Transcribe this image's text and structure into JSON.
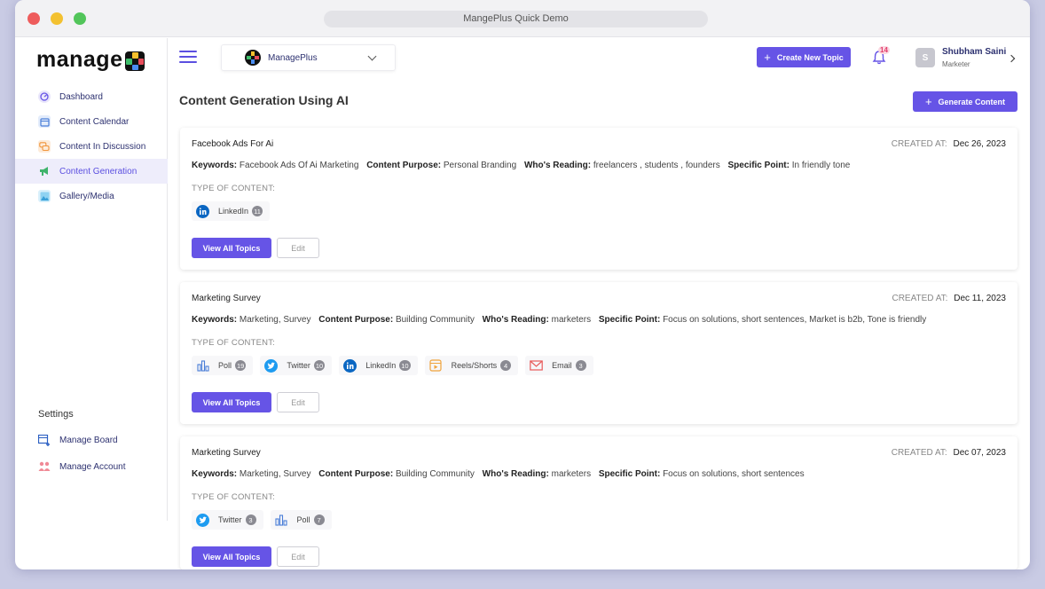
{
  "window": {
    "title": "MangePlus Quick Demo"
  },
  "logo": {
    "text": "manage"
  },
  "sidebar": {
    "items": [
      {
        "label": "Dashboard",
        "icon": "dashboard-icon"
      },
      {
        "label": "Content Calendar",
        "icon": "calendar-icon"
      },
      {
        "label": "Content In Discussion",
        "icon": "discussion-icon"
      },
      {
        "label": "Content Generation",
        "icon": "megaphone-icon"
      },
      {
        "label": "Gallery/Media",
        "icon": "gallery-icon"
      }
    ],
    "settings_title": "Settings",
    "settings_items": [
      {
        "label": "Manage Board",
        "icon": "board-icon"
      },
      {
        "label": "Manage Account",
        "icon": "account-icon"
      }
    ]
  },
  "header": {
    "board_name": "ManagePlus",
    "create_topic_label": "Create New Topic",
    "notification_count": "14",
    "user_initial": "S",
    "user_name": "Shubham Saini",
    "user_role": "Marketer"
  },
  "main": {
    "title": "Content Generation Using AI",
    "generate_label": "Generate Content",
    "created_label": "CREATED AT:",
    "keywords_label": "Keywords:",
    "purpose_label": "Content Purpose:",
    "reading_label": "Who's Reading:",
    "specific_label": "Specific Point:",
    "type_label": "TYPE OF CONTENT:",
    "view_label": "View All Topics",
    "edit_label": "Edit",
    "cards": [
      {
        "title": "Facebook Ads For Ai",
        "date": "Dec 26, 2023",
        "keywords": "Facebook Ads Of Ai Marketing",
        "purpose": "Personal Branding",
        "reading": "freelancers , students , founders",
        "specific": "In friendly tone",
        "chips": [
          {
            "label": "LinkedIn",
            "count": "11",
            "icon": "linkedin-icon"
          }
        ]
      },
      {
        "title": "Marketing Survey",
        "date": "Dec 11, 2023",
        "keywords": "Marketing, Survey",
        "purpose": "Building Community",
        "reading": "marketers",
        "specific": "Focus on solutions, short sentences, Market is b2b, Tone is friendly",
        "chips": [
          {
            "label": "Poll",
            "count": "19",
            "icon": "poll-icon"
          },
          {
            "label": "Twitter",
            "count": "10",
            "icon": "twitter-icon"
          },
          {
            "label": "LinkedIn",
            "count": "10",
            "icon": "linkedin-icon"
          },
          {
            "label": "Reels/Shorts",
            "count": "4",
            "icon": "reels-icon"
          },
          {
            "label": "Email",
            "count": "3",
            "icon": "email-icon"
          }
        ]
      },
      {
        "title": "Marketing Survey",
        "date": "Dec 07, 2023",
        "keywords": "Marketing, Survey",
        "purpose": "Building Community",
        "reading": "marketers",
        "specific": "Focus on solutions, short sentences",
        "chips": [
          {
            "label": "Twitter",
            "count": "3",
            "icon": "twitter-icon"
          },
          {
            "label": "Poll",
            "count": "7",
            "icon": "poll-icon"
          }
        ]
      }
    ]
  },
  "colors": {
    "accent": "#6654e6",
    "nav_text": "#2d3170",
    "active_bg": "#eeedfb"
  }
}
